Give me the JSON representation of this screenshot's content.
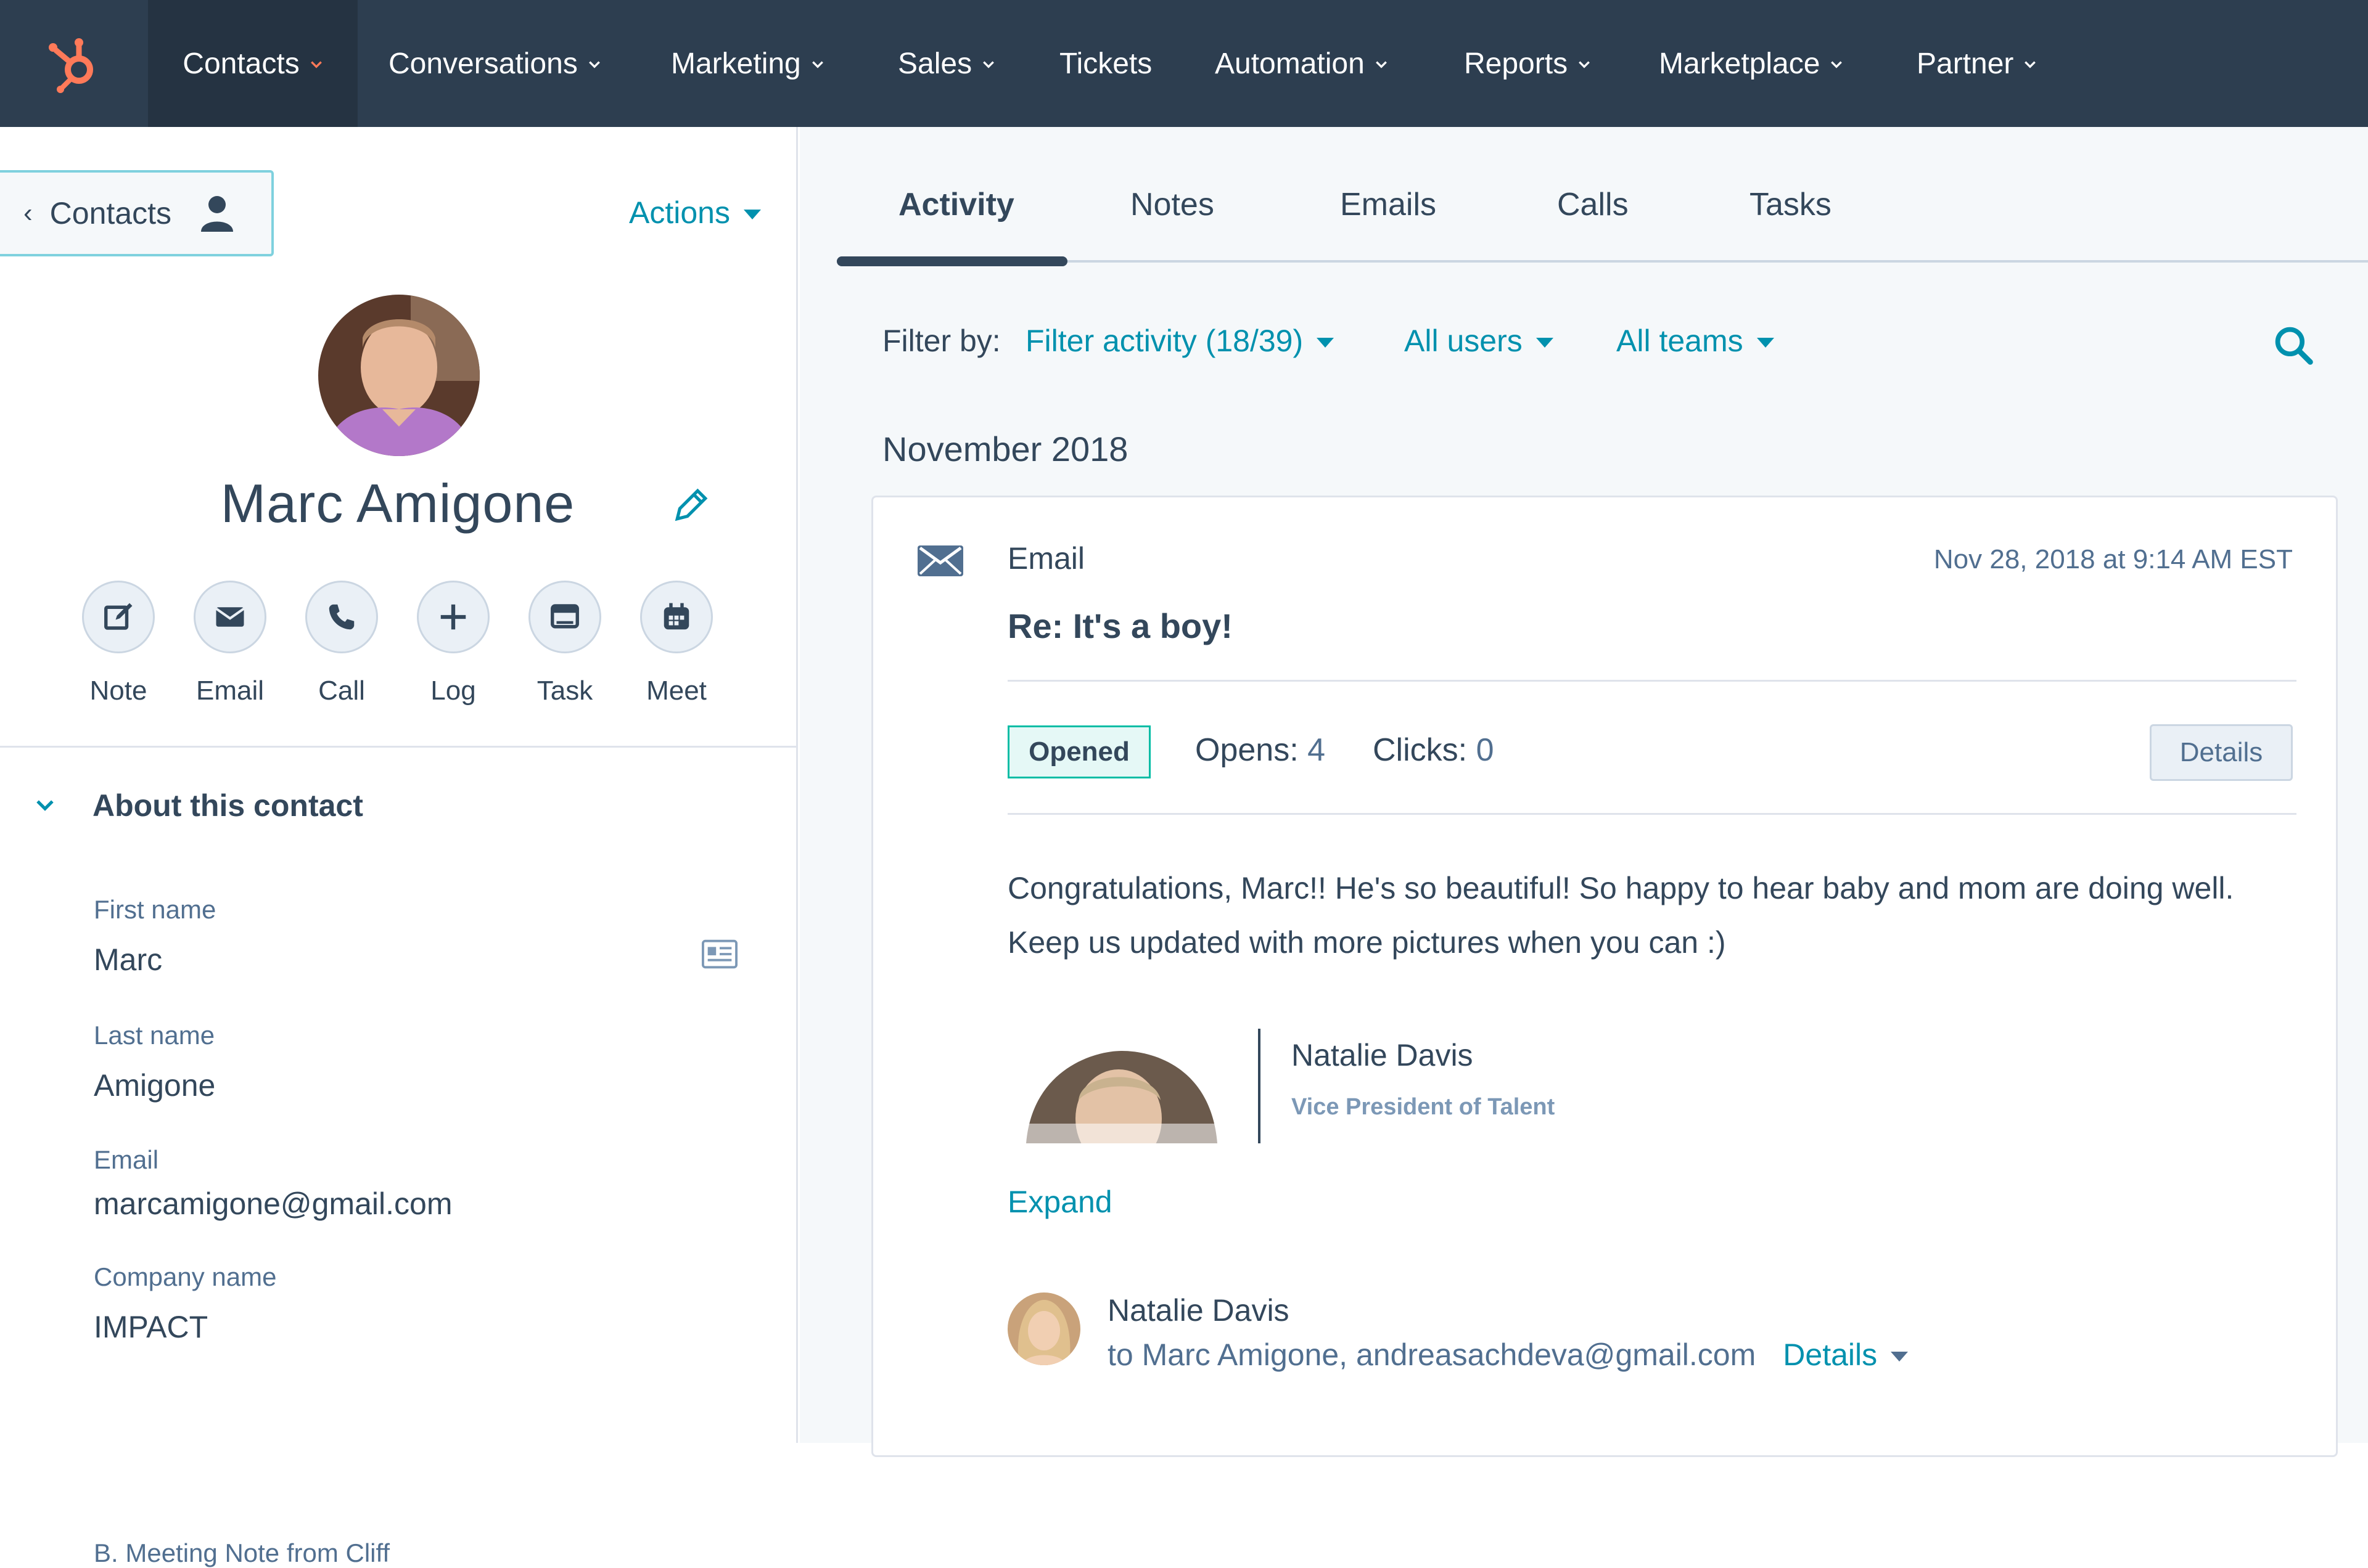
{
  "nav": {
    "items": [
      {
        "label": "Contacts",
        "dropdown": true
      },
      {
        "label": "Conversations",
        "dropdown": true
      },
      {
        "label": "Marketing",
        "dropdown": true
      },
      {
        "label": "Sales",
        "dropdown": true
      },
      {
        "label": "Tickets",
        "dropdown": false
      },
      {
        "label": "Automation",
        "dropdown": true
      },
      {
        "label": "Reports",
        "dropdown": true
      },
      {
        "label": "Marketplace",
        "dropdown": true
      },
      {
        "label": "Partner",
        "dropdown": true
      }
    ]
  },
  "sidebar": {
    "back_label": "Contacts",
    "actions_label": "Actions",
    "contact_name": "Marc Amigone",
    "quick_actions": [
      {
        "label": "Note",
        "icon": "note-icon"
      },
      {
        "label": "Email",
        "icon": "email-icon"
      },
      {
        "label": "Call",
        "icon": "phone-icon"
      },
      {
        "label": "Log",
        "icon": "plus-icon"
      },
      {
        "label": "Task",
        "icon": "task-icon"
      },
      {
        "label": "Meet",
        "icon": "calendar-icon"
      }
    ],
    "about_heading": "About this contact",
    "fields": [
      {
        "label": "First name",
        "value": "Marc"
      },
      {
        "label": "Last name",
        "value": "Amigone"
      },
      {
        "label": "Email",
        "value": "marcamigone@gmail.com"
      },
      {
        "label": "Company name",
        "value": "IMPACT"
      }
    ],
    "cut_off_text": "B. Meeting Note from Cliff"
  },
  "tabs": [
    "Activity",
    "Notes",
    "Emails",
    "Calls",
    "Tasks"
  ],
  "filters": {
    "label": "Filter by:",
    "activity": "Filter activity (18/39)",
    "users": "All users",
    "teams": "All teams"
  },
  "timeline": {
    "month": "November 2018",
    "card": {
      "type": "Email",
      "date": "Nov 28, 2018 at 9:14 AM EST",
      "subject": "Re: It's a boy!",
      "status": "Opened",
      "opens_label": "Opens:",
      "opens": "4",
      "clicks_label": "Clicks:",
      "clicks": "0",
      "details_label": "Details",
      "body": "Congratulations, Marc!! He's so beautiful! So happy to hear baby and mom are doing well. Keep us updated with more pictures when you can :)",
      "signature_name": "Natalie Davis",
      "signature_title": "Vice President of Talent",
      "expand_label": "Expand",
      "sender_name": "Natalie Davis",
      "sender_to": "to Marc Amigone, andreasachdeva@gmail.com",
      "sender_details_label": "Details"
    }
  },
  "colors": {
    "nav_bg": "#2d3e50",
    "link": "#0091ae",
    "text": "#33475b",
    "hubspot_orange": "#ff7a59",
    "opened_green": "#00bda5"
  }
}
